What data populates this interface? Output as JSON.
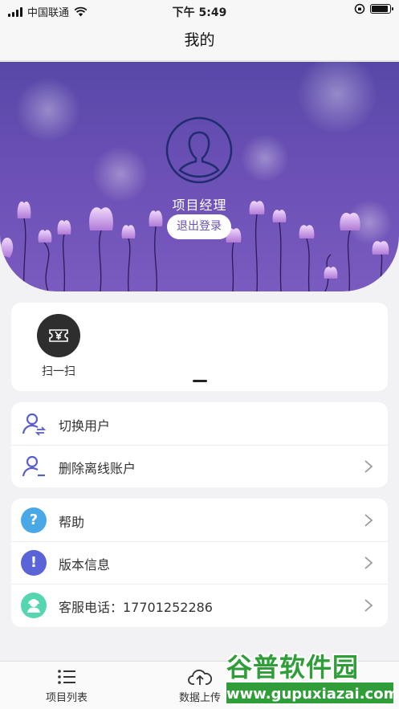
{
  "status_bar": {
    "carrier": "中国联通",
    "time": "下午 5:49",
    "battery_level": 0.9
  },
  "nav": {
    "title": "我的"
  },
  "profile": {
    "role": "项目经理",
    "logout_label": "退出登录",
    "avatar_icon": "user-silhouette-icon"
  },
  "quick_actions": {
    "scan": {
      "label": "扫一扫",
      "icon": "yen-ticket-icon"
    }
  },
  "account_menu": [
    {
      "label": "切换用户",
      "icon": "switch-user-icon",
      "chevron": false
    },
    {
      "label": "删除离线账户",
      "icon": "remove-user-icon",
      "chevron": true
    }
  ],
  "info_menu": [
    {
      "label": "帮助",
      "icon": "help-icon",
      "color": "#4aa8e6",
      "glyph": "?"
    },
    {
      "label": "版本信息",
      "icon": "info-icon",
      "color": "#5a63d8",
      "glyph": "!"
    },
    {
      "label": "客服电话：17701252286",
      "icon": "customer-service-icon",
      "color": "#55d6b0"
    }
  ],
  "tabs": [
    {
      "label": "项目列表",
      "icon": "list-icon"
    },
    {
      "label": "数据上传",
      "icon": "cloud-upload-icon"
    }
  ],
  "watermark": {
    "title": "谷普软件园",
    "url": "www.gupuxiazai.com"
  },
  "colors": {
    "hero_top": "#5848a8",
    "hero_bottom": "#7a5bbf",
    "accent": "#6a4fb4",
    "icon_purple": "#5a5fc8",
    "watermark_green": "#2f9e38"
  }
}
